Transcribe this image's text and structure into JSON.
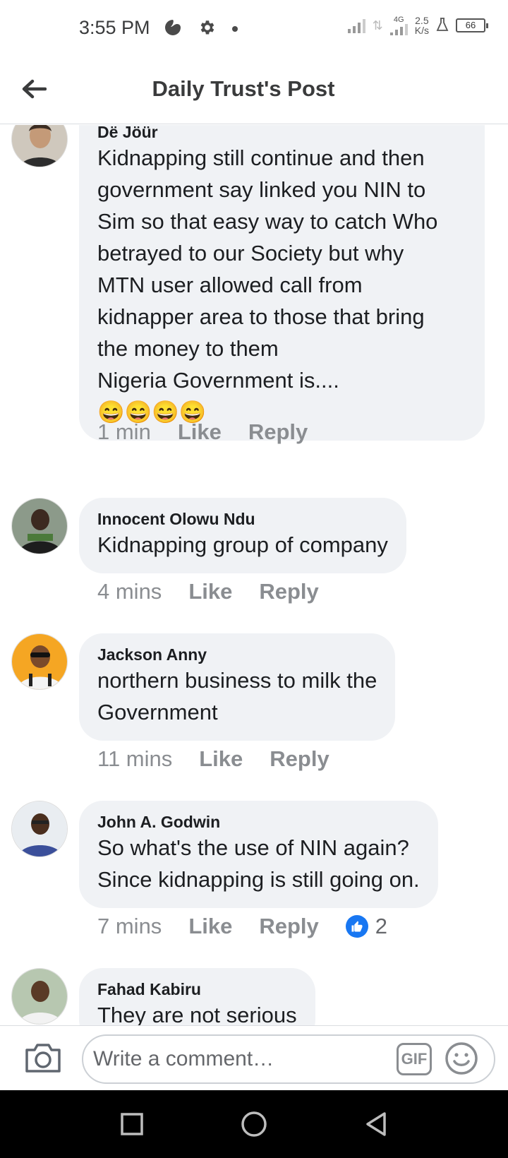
{
  "status_bar": {
    "time": "3:55 PM",
    "network_type": "4G",
    "net_speed_value": "2.5",
    "net_speed_unit": "K/s",
    "battery": "66"
  },
  "header": {
    "title": "Daily Trust's Post"
  },
  "comments": [
    {
      "author": "Dë Jöür",
      "lines": [
        "Kidnapping still continue and then",
        "government say linked you NIN to",
        "Sim so that easy way to catch Who",
        "betrayed to our Society but why",
        "MTN user allowed call from",
        "kidnapper area to those that bring",
        "the money to them",
        "Nigeria Government is....",
        "😄😄😄😄"
      ],
      "time": "1 min",
      "like_label": "Like",
      "reply_label": "Reply"
    },
    {
      "author": "Innocent Olowu Ndu",
      "lines": [
        "Kidnapping group of company"
      ],
      "time": "4 mins",
      "like_label": "Like",
      "reply_label": "Reply"
    },
    {
      "author": "Jackson Anny",
      "lines": [
        "northern business to milk the",
        "Government"
      ],
      "time": "11 mins",
      "like_label": "Like",
      "reply_label": "Reply"
    },
    {
      "author": "John A. Godwin",
      "lines": [
        "So what's the use of NIN again?",
        "Since kidnapping is still going on."
      ],
      "time": "7 mins",
      "like_label": "Like",
      "reply_label": "Reply",
      "reaction_count": "2"
    },
    {
      "author": "Fahad Kabiru",
      "lines": [
        "They are not serious"
      ]
    }
  ],
  "composer": {
    "placeholder": "Write a comment…",
    "gif_label": "GIF"
  },
  "colors": {
    "bubble_bg": "#f0f2f5",
    "meta_text": "#8a8d91",
    "like_blue": "#1877f2",
    "nav_bg": "#000000"
  }
}
